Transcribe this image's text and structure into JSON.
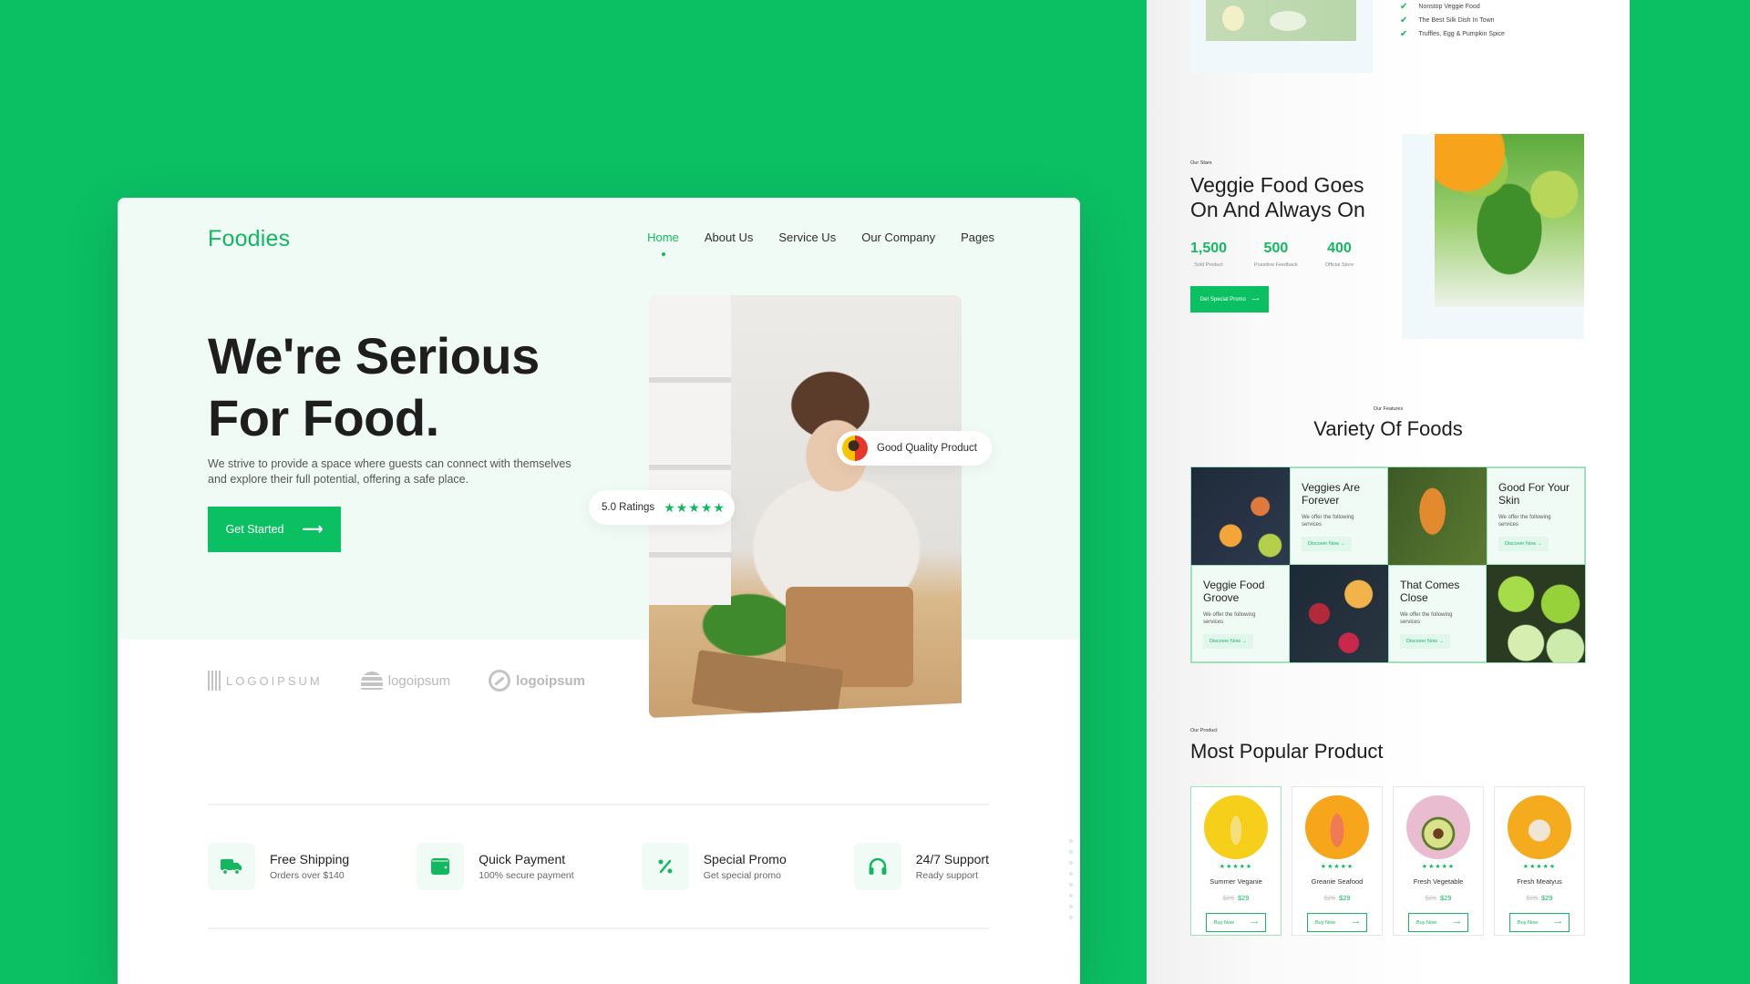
{
  "colors": {
    "brand": "#0bbf63",
    "accent_text": "#14b861",
    "hero_bg": "#f1fbf6"
  },
  "header": {
    "logo": "Foodies",
    "nav": [
      {
        "label": "Home",
        "active": true
      },
      {
        "label": "About Us"
      },
      {
        "label": "Service Us"
      },
      {
        "label": "Our Company"
      },
      {
        "label": "Pages"
      }
    ]
  },
  "hero": {
    "title_line1": "We're Serious",
    "title_line2": "For Food.",
    "description": "We strive to provide a space where guests can connect with themselves and explore their full potential, offering a safe place.",
    "cta_label": "Get Started",
    "cta_icon": "arrow-right-icon",
    "quality_badge": "Good Quality Product",
    "rating_label": "5.0 Ratings",
    "rating_stars": 5
  },
  "partner_logos": [
    {
      "name": "LOGOIPSUM",
      "icon": "bars-logo-icon"
    },
    {
      "name": "logoipsum",
      "icon": "sun-waves-logo-icon"
    },
    {
      "name": "logoipsum",
      "icon": "ring-logo-icon"
    }
  ],
  "features": [
    {
      "title": "Free Shipping",
      "subtitle": "Orders over $140",
      "icon": "truck-icon",
      "glyph": "🚚"
    },
    {
      "title": "Quick Payment",
      "subtitle": "100% secure payment",
      "icon": "wallet-icon",
      "glyph": "▬"
    },
    {
      "title": "Special Promo",
      "subtitle": "Get special promo",
      "icon": "percent-icon",
      "glyph": "%"
    },
    {
      "title": "24/7 Support",
      "subtitle": "Ready support",
      "icon": "headphones-icon",
      "glyph": "🎧"
    }
  ],
  "side": {
    "checklist": [
      "Nonstop Veggie Food",
      "The Best Silk Dish In Town",
      "Truffles, Egg & Pumpkin Spice"
    ],
    "stats_section": {
      "label": "Our Stars",
      "title_line1": "Veggie Food Goes",
      "title_line2": "On And Always On",
      "stats": [
        {
          "value": "1,500",
          "label": "Sold Product"
        },
        {
          "value": "500",
          "label": "Possitive Feedback"
        },
        {
          "value": "400",
          "label": "Official Store"
        }
      ],
      "button_label": "Get Special Promo"
    },
    "features_section": {
      "label": "Our Features",
      "title": "Variety Of Foods",
      "cards": [
        {
          "title": "Veggies Are Forever",
          "subtitle": "We offer the following services",
          "button": "Discover Now →"
        },
        {
          "title": "Good For Your Skin",
          "subtitle": "We offer the following services",
          "button": "Discover Now →"
        },
        {
          "title": "Veggie Food Groove",
          "subtitle": "We offer the following services",
          "button": "Discover Now →"
        },
        {
          "title": "That Comes Close",
          "subtitle": "We offer the following services",
          "button": "Discover Now →"
        }
      ]
    },
    "products_section": {
      "label": "Our Product",
      "title": "Most Popular Product",
      "products": [
        {
          "name": "Summer Veganie",
          "old_price": "$26",
          "price": "$29",
          "stars": 5,
          "button": "Buy Now",
          "color": "#f6cf1a"
        },
        {
          "name": "Greanie Seafood",
          "old_price": "$26",
          "price": "$29",
          "stars": 5,
          "button": "Buy Now",
          "color": "#f7a51b"
        },
        {
          "name": "Fresh Vegetable",
          "old_price": "$26",
          "price": "$29",
          "stars": 5,
          "button": "Buy Now",
          "color": "#e9bcd0"
        },
        {
          "name": "Fresh Meatyus",
          "old_price": "$26",
          "price": "$29",
          "stars": 5,
          "button": "Buy Now",
          "color": "#f4ac1e"
        }
      ]
    }
  }
}
